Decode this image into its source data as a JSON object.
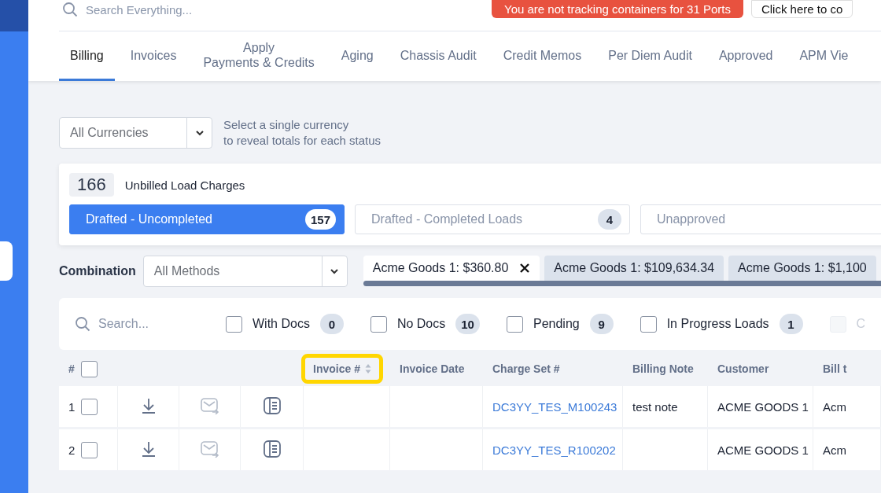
{
  "top_bar": {
    "search": {
      "placeholder": "Search Everything..."
    },
    "alert": "You are not tracking containers for 31 Ports",
    "alert_action": "Click here to co"
  },
  "tabs": [
    {
      "label": "Billing",
      "selected": true
    },
    {
      "label": "Invoices",
      "selected": false
    },
    {
      "label": "Apply\nPayments & Credits",
      "selected": false
    },
    {
      "label": "Aging",
      "selected": false
    },
    {
      "label": "Chassis Audit",
      "selected": false
    },
    {
      "label": "Credit Memos",
      "selected": false
    },
    {
      "label": "Per Diem Audit",
      "selected": false
    },
    {
      "label": "Approved",
      "selected": false
    },
    {
      "label": "APM Vie",
      "selected": false
    }
  ],
  "currency": {
    "value": "All Currencies",
    "hint": "Select a single currency\nto reveal totals for each status"
  },
  "summary": {
    "count": "166",
    "title": "Unbilled Load Charges",
    "statuses": [
      {
        "label": "Drafted - Uncompleted",
        "count": "157",
        "selected": true
      },
      {
        "label": "Drafted - Completed Loads",
        "count": "4",
        "selected": false
      },
      {
        "label": "Unapproved",
        "selected": false
      }
    ]
  },
  "combination": {
    "label": "Combination",
    "value": "All Methods",
    "chips": [
      {
        "label": "Acme Goods 1: $360.80",
        "selected": true
      },
      {
        "label": "Acme Goods 1: $109,634.34",
        "selected": false
      },
      {
        "label": "Acme Goods 1: $1,100",
        "selected": false
      }
    ]
  },
  "filters": {
    "search": {
      "placeholder": "Search..."
    },
    "items": [
      {
        "label": "With Docs",
        "count": "0",
        "checked": false,
        "disabled": false
      },
      {
        "label": "No Docs",
        "count": "10",
        "checked": false,
        "disabled": false
      },
      {
        "label": "Pending",
        "count": "9",
        "checked": false,
        "disabled": false
      },
      {
        "label": "In Progress Loads",
        "count": "1",
        "checked": false,
        "disabled": false
      },
      {
        "label": "C",
        "checked": false,
        "disabled": true
      }
    ]
  },
  "table": {
    "select_all": {
      "checked": false
    },
    "columns": [
      {
        "label": "#",
        "highlighted": false
      },
      {
        "label": "Invoice #",
        "highlighted": true,
        "sortable": true
      },
      {
        "label": "Invoice Date",
        "highlighted": false
      },
      {
        "label": "Charge Set #",
        "highlighted": false
      },
      {
        "label": "Billing Note",
        "highlighted": false
      },
      {
        "label": "Customer",
        "highlighted": false
      },
      {
        "label": "Bill t",
        "highlighted": false
      }
    ],
    "rows": [
      {
        "number": "1",
        "checked": false,
        "charge_set": "DC3YY_TES_M100243",
        "billing_note": "test note",
        "customer": "ACME GOODS 1",
        "bill_to": "Acm"
      },
      {
        "number": "2",
        "checked": false,
        "charge_set": "DC3YY_TES_R100202",
        "customer": "ACME GOODS 1",
        "bill_to": "Acm"
      }
    ]
  }
}
